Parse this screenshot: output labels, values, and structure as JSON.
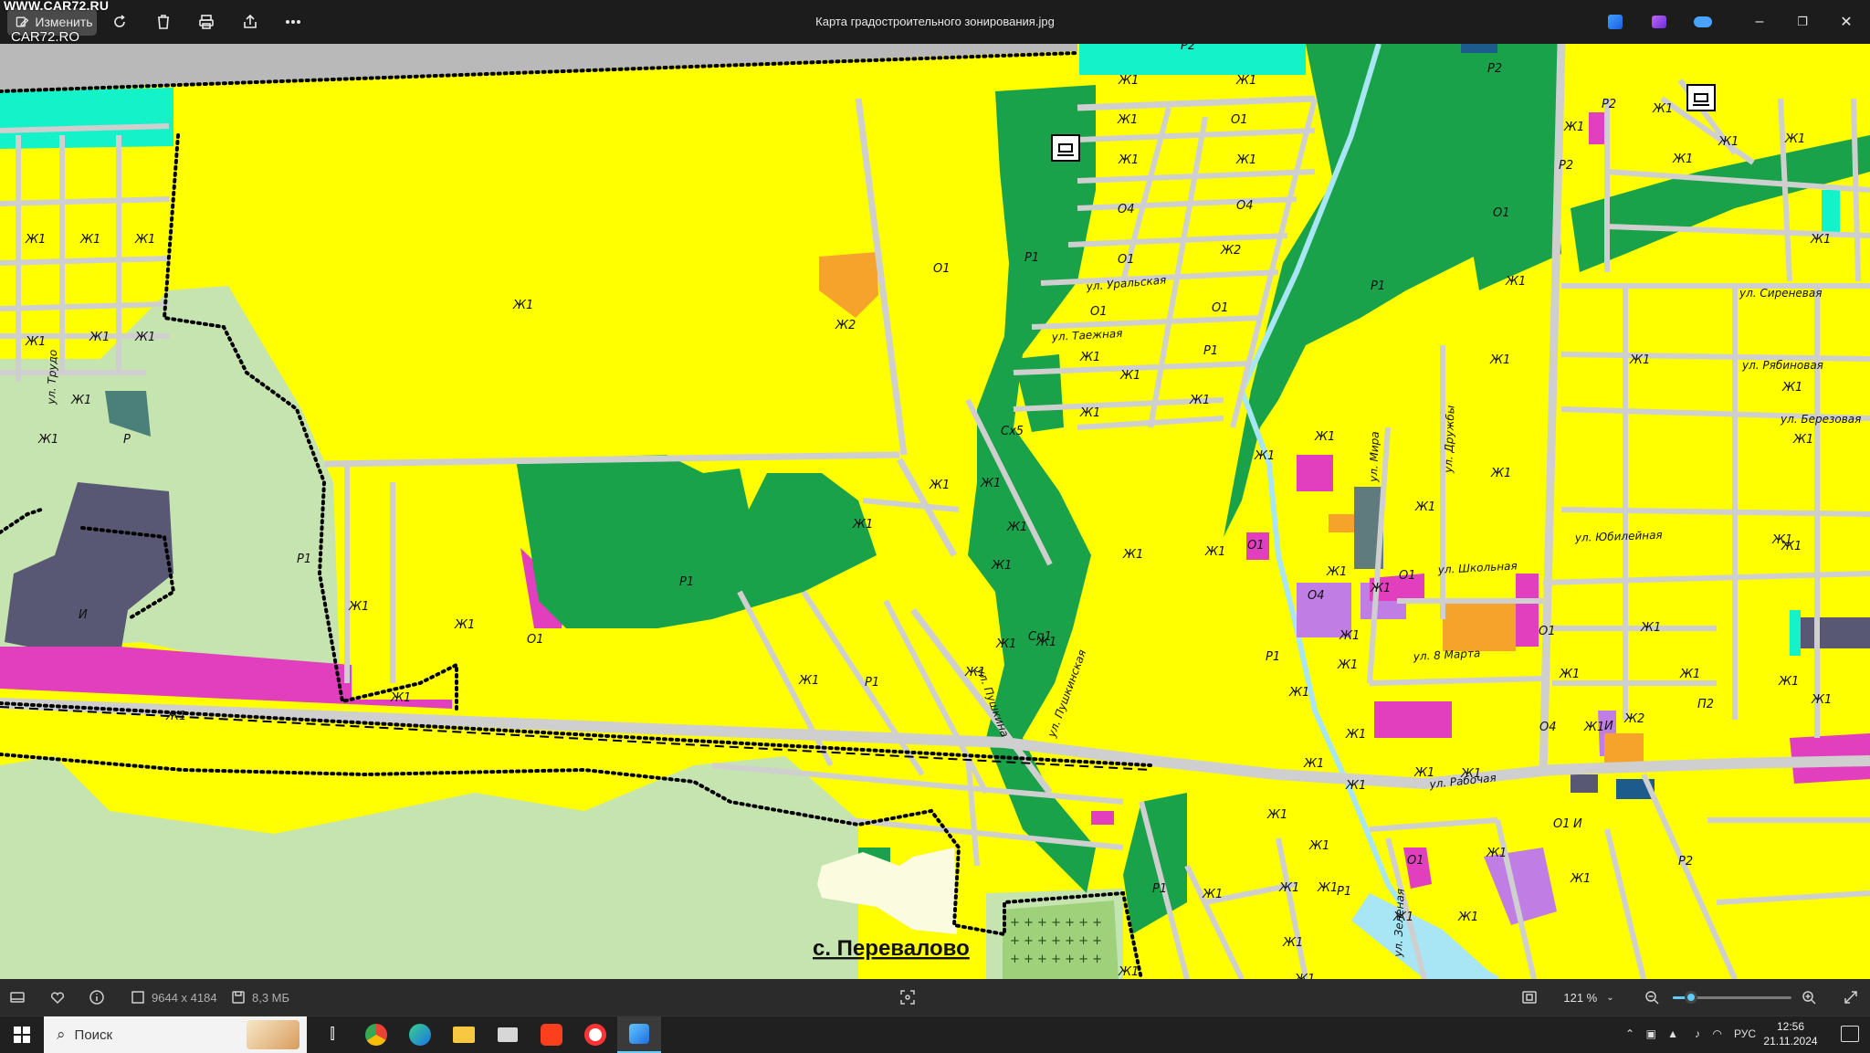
{
  "window": {
    "title": "Карта градостроительного зонирования.jpg",
    "watermark_top": "WWW.CAR72.RU",
    "watermark_bottom": "CAR72.RO",
    "edit_label": "Изменить"
  },
  "toolbar": {
    "icons": [
      "edit-icon",
      "rotate-icon",
      "delete-icon",
      "print-icon",
      "share-icon",
      "more-icon"
    ],
    "right_icons": [
      "photo-app-icon",
      "clipchamp-icon",
      "onedrive-icon"
    ],
    "controls": [
      "minimize",
      "restore",
      "close"
    ]
  },
  "map": {
    "place_name": "с. Перевалово",
    "colors": {
      "zh1": "#ffff00",
      "zh2": "#f6a32b",
      "r1": "#1aa24b",
      "r2": "#13f2c8",
      "o1": "#e13fbe",
      "o4": "#c07ee4",
      "i": "#585874",
      "agri": "#c6e4b0",
      "road": "#d8d8d8",
      "water": "#a8e6f5"
    },
    "zones": [
      {
        "id": "z1",
        "label": "Ж1"
      },
      {
        "id": "z2",
        "label": "Ж1"
      },
      {
        "id": "z3",
        "label": "Ж1"
      },
      {
        "id": "z4",
        "label": "Ж1"
      },
      {
        "id": "z5",
        "label": "Ж1"
      },
      {
        "id": "z6",
        "label": "Ж1"
      },
      {
        "id": "z7",
        "label": "Ж1"
      },
      {
        "id": "z8",
        "label": "Р"
      },
      {
        "id": "z9",
        "label": "Ж1"
      },
      {
        "id": "z10",
        "label": "Ж2"
      },
      {
        "id": "z11",
        "label": "Ж1"
      },
      {
        "id": "z12",
        "label": "И"
      },
      {
        "id": "z13",
        "label": "Р1"
      },
      {
        "id": "z14",
        "label": "Ж1"
      },
      {
        "id": "z15",
        "label": "Ж1"
      },
      {
        "id": "z16",
        "label": "О1"
      },
      {
        "id": "z17",
        "label": "Р1"
      },
      {
        "id": "z18",
        "label": "Ж1"
      },
      {
        "id": "z19",
        "label": "Ж1"
      },
      {
        "id": "z20",
        "label": "О1"
      },
      {
        "id": "z21",
        "label": "Ж1"
      },
      {
        "id": "z22",
        "label": "Ж1"
      },
      {
        "id": "z23",
        "label": "Ж1"
      },
      {
        "id": "z24",
        "label": "Ж1"
      },
      {
        "id": "z25",
        "label": "Р1"
      },
      {
        "id": "z26",
        "label": "Сх5"
      },
      {
        "id": "z27",
        "label": "Ж1"
      },
      {
        "id": "z28",
        "label": "Сп1"
      },
      {
        "id": "z29",
        "label": "Ж1"
      },
      {
        "id": "z30",
        "label": "Р1"
      },
      {
        "id": "z31",
        "label": "Ж1"
      },
      {
        "id": "z32",
        "label": "Ж1"
      },
      {
        "id": "z33",
        "label": "Ж1"
      },
      {
        "id": "z34",
        "label": "Ж1"
      },
      {
        "id": "z35",
        "label": "Р1"
      },
      {
        "id": "z36",
        "label": "Ж1"
      },
      {
        "id": "z37",
        "label": "Ж1"
      },
      {
        "id": "z38",
        "label": "Ж1"
      },
      {
        "id": "z39",
        "label": "Ж1"
      },
      {
        "id": "z40",
        "label": "Ж1"
      },
      {
        "id": "z41",
        "label": "Ж1"
      },
      {
        "id": "z42",
        "label": "Ж1"
      },
      {
        "id": "z43",
        "label": "Ж1"
      },
      {
        "id": "z44",
        "label": "Ж1"
      },
      {
        "id": "z45",
        "label": "Ж1"
      },
      {
        "id": "z46",
        "label": "Ж1"
      },
      {
        "id": "z47",
        "label": "Ж1"
      },
      {
        "id": "z48",
        "label": "Ж1"
      },
      {
        "id": "z49",
        "label": "Р1"
      },
      {
        "id": "z50",
        "label": "Р2"
      },
      {
        "id": "z51",
        "label": "Ж1"
      },
      {
        "id": "z52",
        "label": "Ж1"
      },
      {
        "id": "z53",
        "label": "Р1"
      },
      {
        "id": "z54",
        "label": "Ж1"
      },
      {
        "id": "z55",
        "label": "О1"
      },
      {
        "id": "z56",
        "label": "Ж1"
      },
      {
        "id": "z57",
        "label": "Ж1"
      },
      {
        "id": "z58",
        "label": "О4"
      },
      {
        "id": "z59",
        "label": "О4"
      },
      {
        "id": "z60",
        "label": "О1"
      },
      {
        "id": "z61",
        "label": "Ж2"
      },
      {
        "id": "z62",
        "label": "О1"
      },
      {
        "id": "z63",
        "label": "О1"
      },
      {
        "id": "z64",
        "label": "Ж1"
      },
      {
        "id": "z65",
        "label": "Р1"
      },
      {
        "id": "z66",
        "label": "Ж1"
      },
      {
        "id": "z67",
        "label": "Ж1"
      },
      {
        "id": "z68",
        "label": "Ж1"
      },
      {
        "id": "z69",
        "label": "Ж1"
      },
      {
        "id": "z70",
        "label": "О1"
      },
      {
        "id": "z71",
        "label": "Ж1"
      },
      {
        "id": "z72",
        "label": "Ж1"
      },
      {
        "id": "z73",
        "label": "Ж1"
      },
      {
        "id": "z74",
        "label": "О4"
      },
      {
        "id": "z75",
        "label": "Ж1"
      },
      {
        "id": "z76",
        "label": "Ж1"
      },
      {
        "id": "z77",
        "label": "Ж1"
      },
      {
        "id": "z78",
        "label": "О1"
      },
      {
        "id": "z79",
        "label": "Ж1"
      },
      {
        "id": "z80",
        "label": "Р2"
      },
      {
        "id": "z81",
        "label": "Ж1"
      },
      {
        "id": "z82",
        "label": "Р2"
      },
      {
        "id": "z83",
        "label": "О1"
      },
      {
        "id": "z84",
        "label": "Ж1"
      },
      {
        "id": "z85",
        "label": "Ж1"
      },
      {
        "id": "z86",
        "label": "Ж1"
      },
      {
        "id": "z87",
        "label": "Ж1"
      },
      {
        "id": "z88",
        "label": "Р2"
      },
      {
        "id": "z89",
        "label": "Ж1"
      },
      {
        "id": "z90",
        "label": "Ж1"
      },
      {
        "id": "z91",
        "label": "Ж1"
      },
      {
        "id": "z92",
        "label": "Ж1"
      },
      {
        "id": "z93",
        "label": "Ж1"
      },
      {
        "id": "z94",
        "label": "Ж1"
      },
      {
        "id": "z95",
        "label": "Ж1"
      },
      {
        "id": "z96",
        "label": "Ж1"
      },
      {
        "id": "z97",
        "label": "Ж1"
      },
      {
        "id": "z98",
        "label": "Ж1"
      },
      {
        "id": "z99",
        "label": "Ж1"
      },
      {
        "id": "z100",
        "label": "Ж1"
      },
      {
        "id": "z101",
        "label": "О1"
      },
      {
        "id": "z102",
        "label": "П2"
      },
      {
        "id": "z103",
        "label": "Ж1"
      },
      {
        "id": "z104",
        "label": "Ж1"
      },
      {
        "id": "z105",
        "label": "Ж1"
      },
      {
        "id": "z106",
        "label": "Ж1"
      },
      {
        "id": "z107",
        "label": "И"
      },
      {
        "id": "z108",
        "label": "О4"
      },
      {
        "id": "z109",
        "label": "Ж2"
      },
      {
        "id": "z110",
        "label": "О1"
      },
      {
        "id": "z111",
        "label": "И"
      },
      {
        "id": "z112",
        "label": "Р2"
      },
      {
        "id": "z113",
        "label": "О1"
      },
      {
        "id": "z114",
        "label": "Ж1"
      },
      {
        "id": "z115",
        "label": "Р1"
      },
      {
        "id": "z116",
        "label": "Ж1"
      },
      {
        "id": "z117",
        "label": "Ж1"
      },
      {
        "id": "z118",
        "label": "Ж1"
      },
      {
        "id": "z119",
        "label": "Ж1"
      },
      {
        "id": "z120",
        "label": "Ж1"
      }
    ],
    "streets": {
      "s1": "ул. Уральская",
      "s2": "ул. Таежная",
      "s3": "ул. Пушкина",
      "s4": "ул. Пушкинская",
      "s5": "ул. Мира",
      "s6": "ул. Дружбы",
      "s7": "ул. Школьная",
      "s8": "ул. 8 Марта",
      "s9": "ул. Рабочая",
      "s10": "ул. Зеленая",
      "s11": "ул. Сиреневая",
      "s12": "ул. Рябиновая",
      "s13": "ул. Березовая",
      "s14": "ул. Юбилейная",
      "s15": "ул. Трудо"
    }
  },
  "statusbar": {
    "dimensions": "9644 x 4184",
    "file_size": "8,3 МБ",
    "zoom": "121 %",
    "zoom_fraction": 0.15
  },
  "taskbar": {
    "search_placeholder": "Поиск",
    "language": "РУС",
    "time": "12:56",
    "date": "21.11.2024",
    "apps": [
      "task-view-icon",
      "chrome-icon",
      "edge-icon",
      "explorer-icon",
      "terminal-icon",
      "yandex-icon",
      "yandex-browser-icon",
      "photos-icon"
    ]
  }
}
